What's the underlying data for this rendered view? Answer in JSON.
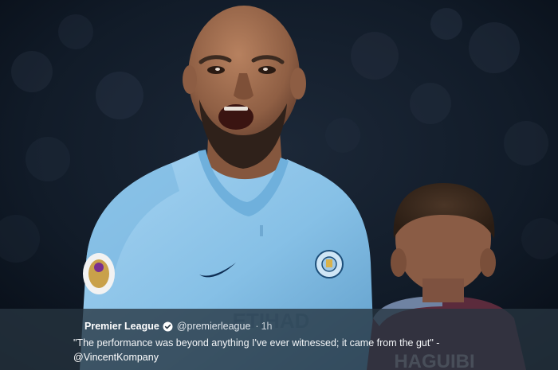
{
  "tweet": {
    "account_name": "Premier League",
    "handle": "@premierleague",
    "separator": "·",
    "time": "1h",
    "text": "\"The performance was beyond anything I've ever witnessed; it came from the gut\" -",
    "mention": "@VincentKompany"
  },
  "photo": {
    "jersey_sponsor_text": "ETIHAD",
    "back_shirt_name": "HAGUIBI",
    "colors": {
      "crowd_background": "#101a27",
      "jersey_sky_blue": "#8ec6ea",
      "skin": "#9a6a4d",
      "opponent_shirt": "#5b2b3c",
      "overlay": "#263440"
    }
  },
  "icons": {
    "verified": "verified-badge-icon"
  }
}
